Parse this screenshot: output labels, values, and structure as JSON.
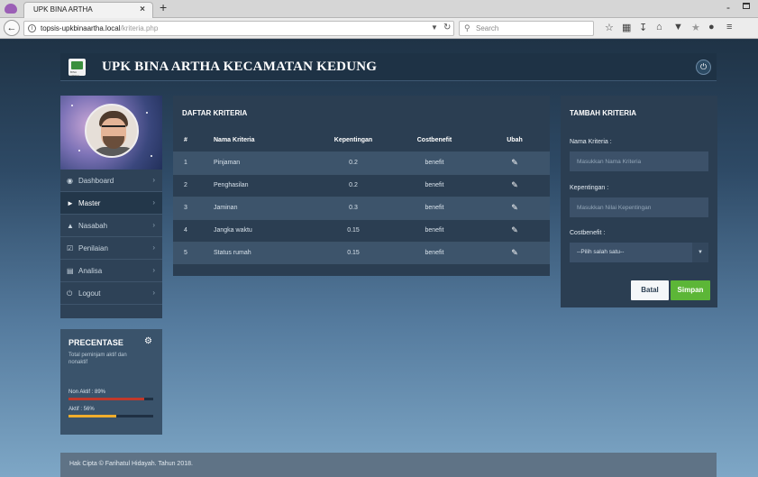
{
  "browser": {
    "tab_title": "UPK BINA ARTHA",
    "tab_close": "×",
    "new_tab": "+",
    "url_host": "topsis-upkbinaartha.local",
    "url_path": "/kriteria.php",
    "search_placeholder": "Search",
    "window_minimize": "-"
  },
  "header": {
    "logo_text": "BINA ARTHA",
    "title": "UPK BINA ARTHA KECAMATAN KEDUNG"
  },
  "sidebar": {
    "items": [
      {
        "label": "Dashboard",
        "icon": "dashboard-icon"
      },
      {
        "label": "Master",
        "icon": "tag-icon"
      },
      {
        "label": "Nasabah",
        "icon": "user-icon"
      },
      {
        "label": "Penilaian",
        "icon": "check-icon"
      },
      {
        "label": "Analisa",
        "icon": "table-icon"
      },
      {
        "label": "Logout",
        "icon": "power-icon"
      }
    ]
  },
  "percentage": {
    "title": "PRECENTASE",
    "description": "Total peminjam aktif dan nonaktif",
    "items": [
      {
        "label": "Non Aktif : 89%",
        "value": 0.89,
        "color": "#c0392b"
      },
      {
        "label": "Aktif : 56%",
        "value": 0.56,
        "color": "#f0ad2c"
      }
    ]
  },
  "daftar": {
    "title": "DAFTAR KRITERIA",
    "columns": [
      "#",
      "Nama Kriteria",
      "Kepentingan",
      "Costbenefit",
      "Ubah"
    ],
    "rows": [
      {
        "no": "1",
        "nama": "Pinjaman",
        "kepentingan": "0.2",
        "costbenefit": "benefit"
      },
      {
        "no": "2",
        "nama": "Penghasilan",
        "kepentingan": "0.2",
        "costbenefit": "benefit"
      },
      {
        "no": "3",
        "nama": "Jaminan",
        "kepentingan": "0.3",
        "costbenefit": "benefit"
      },
      {
        "no": "4",
        "nama": "Jangka waktu",
        "kepentingan": "0.15",
        "costbenefit": "benefit"
      },
      {
        "no": "5",
        "nama": "Status rumah",
        "kepentingan": "0.15",
        "costbenefit": "benefit"
      }
    ]
  },
  "tambah": {
    "title": "TAMBAH KRITERIA",
    "nama_label": "Nama Kriteria :",
    "nama_placeholder": "Masukkan Nama Kriteria",
    "kepentingan_label": "Kepentingan :",
    "kepentingan_placeholder": "Masukkan Nilai Kepentingan",
    "costbenefit_label": "Costbenefit :",
    "costbenefit_value": "--Pilih salah satu--",
    "batal_label": "Batal",
    "simpan_label": "Simpan"
  },
  "footer": {
    "text": "Hak Cipta © Farihatul Hidayah. Tahun 2018."
  },
  "colors": {
    "accent_green": "#5cb637",
    "panel_bg": "#2b3e52",
    "danger": "#c0392b",
    "warning": "#f0ad2c"
  }
}
